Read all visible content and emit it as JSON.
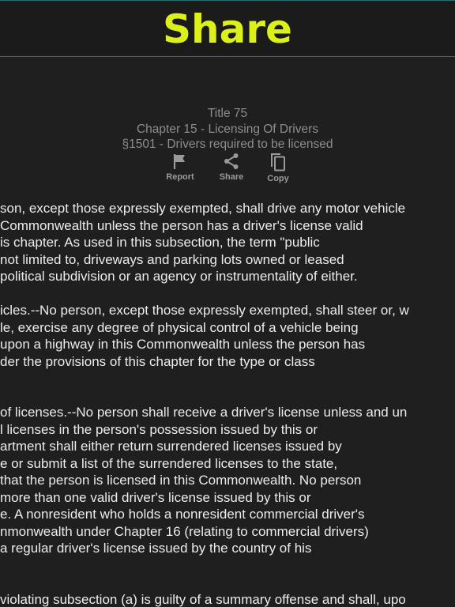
{
  "header": {
    "title": "Share"
  },
  "meta": {
    "title": "Title 75",
    "chapter": "Chapter 15 - Licensing Of Drivers",
    "section": "§1501 - Drivers required to be licensed"
  },
  "actions": {
    "report": {
      "label": "Report",
      "icon": "flag-icon"
    },
    "share": {
      "label": "Share",
      "icon": "share-icon"
    },
    "copy": {
      "label": "Copy",
      "icon": "copy-icon"
    }
  },
  "body": [
    "son, except those expressly exempted, shall drive any motor vehicle",
    "Commonwealth unless the person has a driver's license valid",
    "is chapter. As used in this subsection, the term \"public",
    "not limited to, driveways and parking lots owned or leased",
    "political subdivision or an agency or instrumentality of either.",
    "",
    "icles.--No person, except those expressly exempted, shall steer or, w",
    "le, exercise any degree of physical control of a vehicle being",
    "upon a highway in this Commonwealth unless the person has",
    "der the provisions of this chapter for the type or class",
    "",
    "",
    "of licenses.--No person shall receive a driver's license unless and un",
    "l licenses in the person's possession issued by this or",
    "artment shall either return surrendered licenses issued by",
    "e or submit a list of the surrendered licenses to the state,",
    "that the person is licensed in this Commonwealth. No person",
    " more than one valid driver's license issued by this or",
    "e. A nonresident who holds a nonresident commercial driver's",
    "nmonwealth under Chapter 16 (relating to commercial drivers)",
    " a regular driver's license issued by the country of his",
    "",
    "",
    "violating subsection (a) is guilty of a summary offense and shall, upo"
  ]
}
